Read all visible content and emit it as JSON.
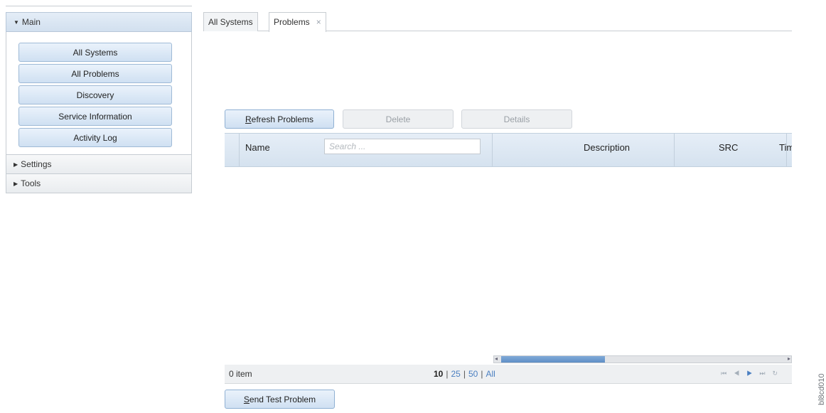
{
  "nav": {
    "sections": [
      {
        "label": "Main",
        "expanded": true,
        "items": [
          "All Systems",
          "All Problems",
          "Discovery",
          "Service Information",
          "Activity Log"
        ]
      },
      {
        "label": "Settings",
        "expanded": false
      },
      {
        "label": "Tools",
        "expanded": false
      }
    ]
  },
  "tabs": [
    {
      "label": "All Systems"
    },
    {
      "label": "Problems",
      "close": "×",
      "active": true
    }
  ],
  "toolbar": {
    "refresh": "Refresh Problems",
    "delete": "Delete",
    "details": "Details"
  },
  "table": {
    "columns": [
      "Name",
      "Description",
      "SRC",
      "Tim"
    ],
    "search_placeholder": "Search ..."
  },
  "footer": {
    "item_count": "0 item",
    "page_sizes": [
      "10",
      "25",
      "50",
      "All"
    ],
    "current_page_size": "10"
  },
  "send_test": "Send Test Problem",
  "watermark": "bl8cd010",
  "colors": {
    "accent": "#4a7fc1",
    "header_bg": "#d5e2ef",
    "button_bg": "#cfe0f2"
  },
  "icons": [
    "triangle-down-icon",
    "triangle-right-icon",
    "close-icon",
    "first-page-icon",
    "prev-page-icon",
    "next-page-icon",
    "last-page-icon",
    "refresh-icon"
  ]
}
